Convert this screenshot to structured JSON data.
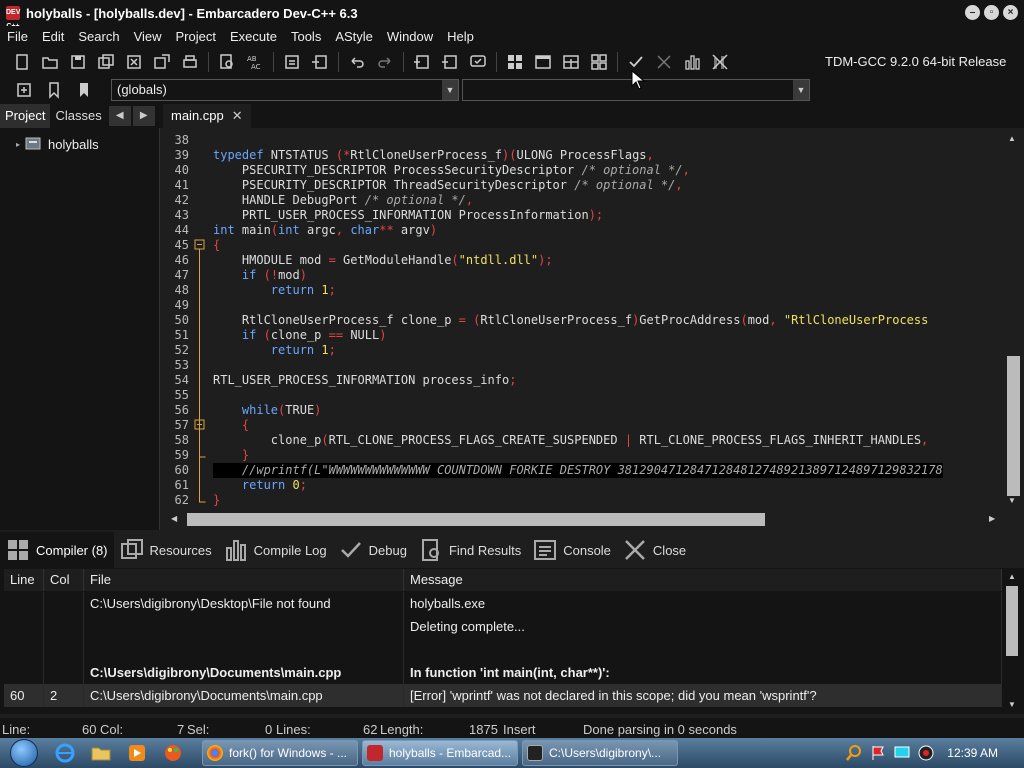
{
  "window": {
    "title": "holyballs - [holyballs.dev] - Embarcadero Dev-C++ 6.3",
    "icon_text": "DEV C++"
  },
  "menu": [
    "File",
    "Edit",
    "Search",
    "View",
    "Project",
    "Execute",
    "Tools",
    "AStyle",
    "Window",
    "Help"
  ],
  "toolbar": {
    "compiler": "TDM-GCC 9.2.0 64-bit Release",
    "scope_combo": "(globals)",
    "function_combo": ""
  },
  "left_panel": {
    "tabs": [
      "Project",
      "Classes"
    ],
    "project_name": "holyballs"
  },
  "editor": {
    "tab_label": "main.cpp",
    "line_numbers": [
      "38",
      "39",
      "40",
      "41",
      "42",
      "43",
      "44",
      "45",
      "46",
      "47",
      "48",
      "49",
      "50",
      "51",
      "52",
      "53",
      "54",
      "55",
      "56",
      "57",
      "58",
      "59",
      "60",
      "61",
      "62"
    ],
    "lines": [
      "",
      "typedef NTSTATUS (*RtlCloneUserProcess_f)(ULONG ProcessFlags,",
      "    PSECURITY_DESCRIPTOR ProcessSecurityDescriptor /* optional */,",
      "    PSECURITY_DESCRIPTOR ThreadSecurityDescriptor /* optional */,",
      "    HANDLE DebugPort /* optional */,",
      "    PRTL_USER_PROCESS_INFORMATION ProcessInformation);",
      "int main(int argc, char** argv)",
      "{",
      "    HMODULE mod = GetModuleHandle(\"ntdll.dll\");",
      "    if (!mod)",
      "        return 1;",
      "",
      "    RtlCloneUserProcess_f clone_p = (RtlCloneUserProcess_f)GetProcAddress(mod, \"RtlCloneUserProcess",
      "    if (clone_p == NULL)",
      "        return 1;",
      "",
      "RTL_USER_PROCESS_INFORMATION process_info;",
      "",
      "    while(TRUE)",
      "    {",
      "        clone_p(RTL_CLONE_PROCESS_FLAGS_CREATE_SUSPENDED | RTL_CLONE_PROCESS_FLAGS_INHERIT_HANDLES,",
      "    }",
      "    //wprintf(L\"WWWWWWWWWWWWWW COUNTDOWN FORKIE DESTROY 381290471284712848127489213897124897129832178",
      "    return 0;",
      "}"
    ]
  },
  "bottom_tabs": [
    "Compiler (8)",
    "Resources",
    "Compile Log",
    "Debug",
    "Find Results",
    "Console",
    "Close"
  ],
  "messages": {
    "headers": [
      "Line",
      "Col",
      "File",
      "Message"
    ],
    "rows": [
      {
        "line": "",
        "col": "",
        "file": "C:\\Users\\digibrony\\Desktop\\File not found",
        "message": "holyballs.exe",
        "bold": false
      },
      {
        "line": "",
        "col": "",
        "file": "",
        "message": "Deleting complete...",
        "bold": false
      },
      {
        "line": "",
        "col": "",
        "file": "",
        "message": "",
        "bold": false
      },
      {
        "line": "",
        "col": "",
        "file": "C:\\Users\\digibrony\\Documents\\main.cpp",
        "message": "In function 'int main(int, char**)':",
        "bold": true
      },
      {
        "line": "60",
        "col": "2",
        "file": "C:\\Users\\digibrony\\Documents\\main.cpp",
        "message": "[Error] 'wprintf' was not declared in this scope; did you mean 'wsprintf'?",
        "bold": false
      }
    ]
  },
  "status": {
    "line_label": "Line:",
    "line_value": "60",
    "col_label": "Col:",
    "col_value": "7",
    "sel_label": "Sel:",
    "sel_value": "0",
    "lines_label": "Lines:",
    "lines_value": "62",
    "length_label": "Length:",
    "length_value": "1875",
    "mode": "Insert",
    "parse": "Done parsing in 0 seconds"
  },
  "taskbar": {
    "tasks": [
      "fork() for Windows - ...",
      "holyballs - Embarcad...",
      "C:\\Users\\digibrony\\..."
    ],
    "clock": "12:39 AM"
  },
  "colors": {
    "keyword": "#6aa6ff",
    "string": "#f0e060",
    "comment": "#aaaaaa",
    "operator": "#e64444",
    "bg": "#1e1e1e"
  }
}
